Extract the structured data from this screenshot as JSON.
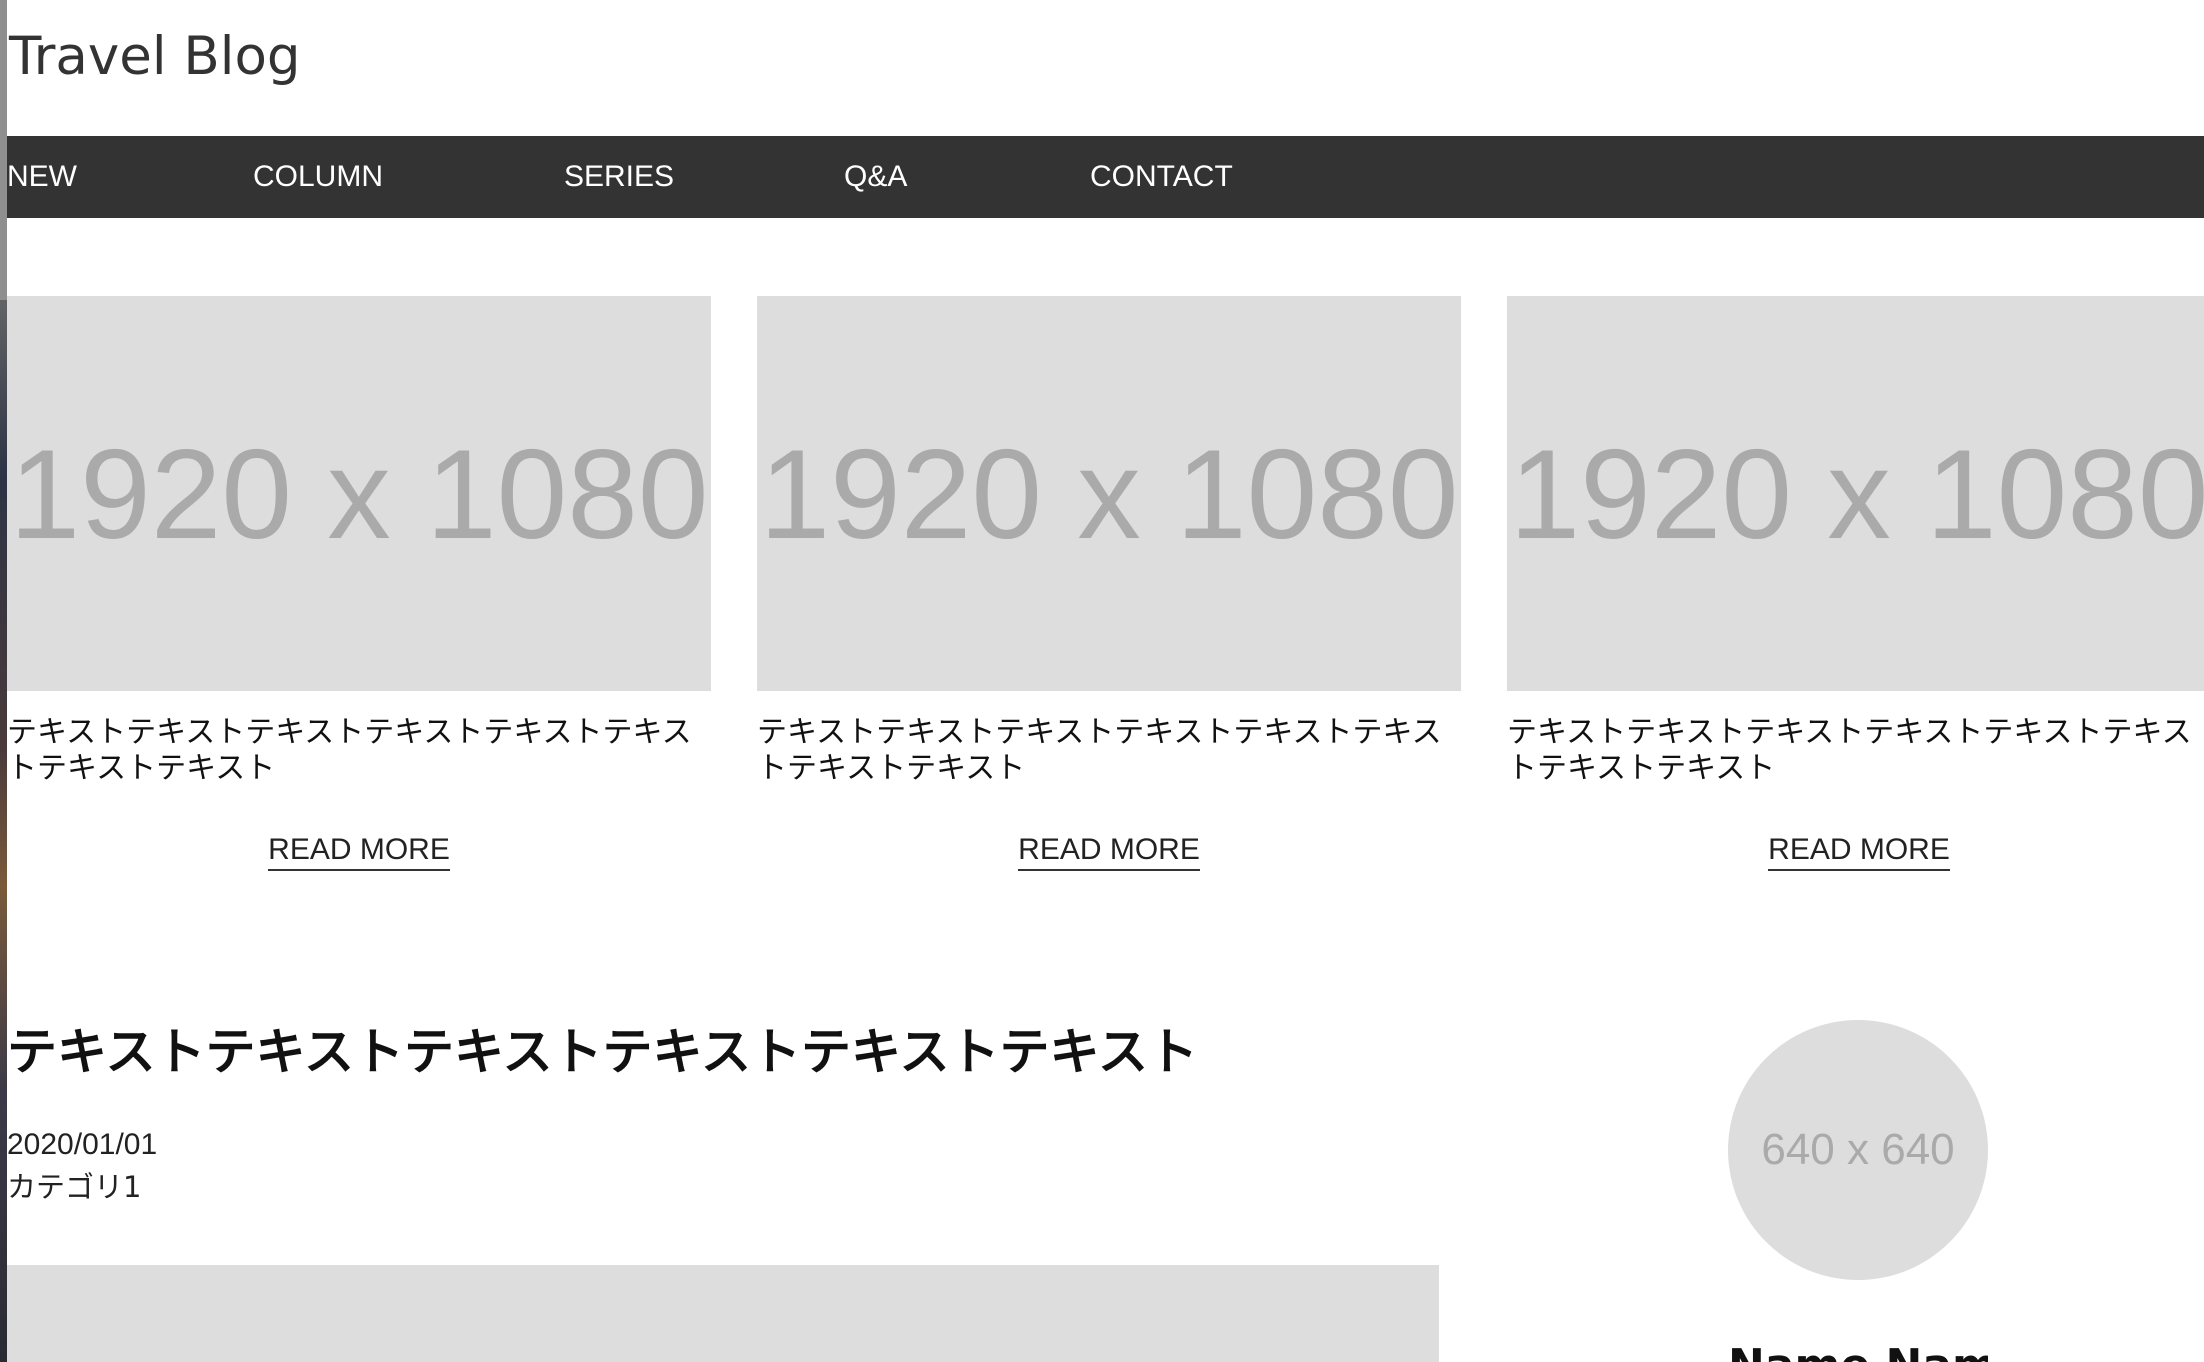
{
  "site": {
    "title": "Travel Blog"
  },
  "nav": {
    "items": [
      {
        "label": "NEW"
      },
      {
        "label": "COLUMN"
      },
      {
        "label": "SERIES"
      },
      {
        "label": "Q&A"
      },
      {
        "label": "CONTACT"
      }
    ]
  },
  "cards": [
    {
      "image_label": "1920 x 1080",
      "text": "テキストテキストテキストテキストテキストテキストテキストテキスト",
      "link": "READ MORE"
    },
    {
      "image_label": "1920 x 1080",
      "text": "テキストテキストテキストテキストテキストテキストテキストテキスト",
      "link": "READ MORE"
    },
    {
      "image_label": "1920 x 1080",
      "text": "テキストテキストテキストテキストテキストテキストテキストテキスト",
      "link": "READ MORE"
    }
  ],
  "article": {
    "title": "テキストテキストテキストテキストテキストテキスト",
    "date": "2020/01/01",
    "category": "カテゴリ1"
  },
  "sidebar": {
    "avatar_label": "640 x 640",
    "author_name": "Name Name"
  },
  "colors": {
    "nav_background": "#333333",
    "placeholder": "#dddddd",
    "placeholder_text": "#aaaaaa"
  }
}
